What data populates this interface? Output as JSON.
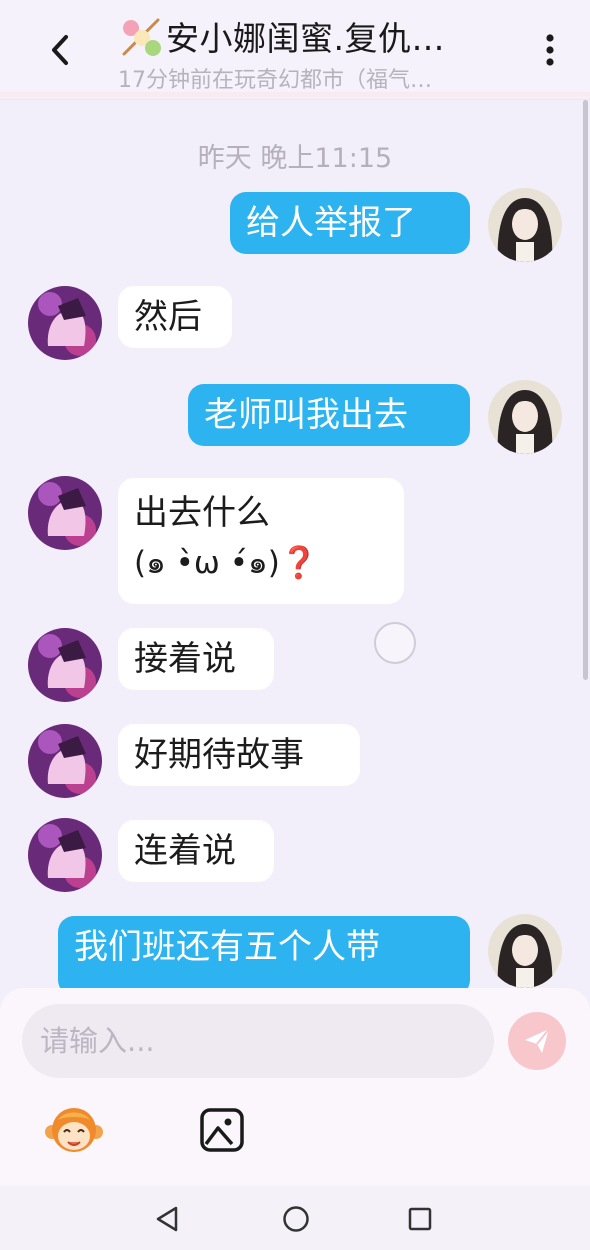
{
  "header": {
    "back_icon": "chevron-left-icon",
    "title_emoji": "dango-icon",
    "title": "安小娜闺蜜.复仇…",
    "subtitle": "17分钟前在玩奇幻都市（福气…",
    "more_icon": "more-vertical-icon"
  },
  "chat": {
    "timestamp": "昨天 晚上11:15",
    "messages": [
      {
        "side": "out",
        "text": "给人举报了"
      },
      {
        "side": "in",
        "text": "然后"
      },
      {
        "side": "out",
        "text": "老师叫我出去"
      },
      {
        "side": "in",
        "text_line1": "出去什么",
        "text_line2": "(๑ •̀ω •́๑)❓"
      },
      {
        "side": "in",
        "text": "接着说"
      },
      {
        "side": "in",
        "text": "好期待故事"
      },
      {
        "side": "in",
        "text": "连着说"
      },
      {
        "side": "out",
        "text": "我们班还有五个人带"
      }
    ]
  },
  "composer": {
    "placeholder": "请输入...",
    "send_icon": "send-icon",
    "tools": [
      "emoji-monkey-icon",
      "image-icon"
    ]
  },
  "navbar": {
    "icons": [
      "nav-back-icon",
      "nav-home-icon",
      "nav-recent-icon"
    ]
  },
  "colors": {
    "background": "#f3effa",
    "outgoing_bubble": "#2db3ef",
    "incoming_bubble": "#ffffff",
    "send_button": "#f7c7cc"
  }
}
